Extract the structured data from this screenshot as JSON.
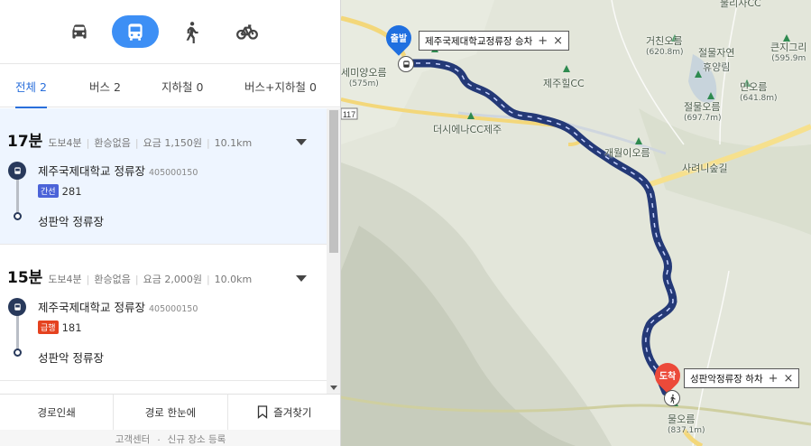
{
  "modes": [
    {
      "key": "car",
      "icon": "car-icon",
      "active": false
    },
    {
      "key": "transit",
      "icon": "bus-icon",
      "active": true
    },
    {
      "key": "walk",
      "icon": "walk-icon",
      "active": false
    },
    {
      "key": "bike",
      "icon": "bicycle-icon",
      "active": false
    }
  ],
  "tabs": [
    {
      "label": "전체 2",
      "active": true
    },
    {
      "label": "버스 2",
      "active": false
    },
    {
      "label": "지하철 0",
      "active": false
    },
    {
      "label": "버스+지하철 0",
      "active": false
    }
  ],
  "routes": [
    {
      "duration": "17분",
      "walk": "도보4분",
      "transfer": "환승없음",
      "fare": "요금 1,150원",
      "distance": "10.1km",
      "start_stop": "제주국제대학교 정류장",
      "stop_id": "405000150",
      "badge": "간선",
      "badge_color": "#4b63d8",
      "bus_no": "281",
      "end_stop": "성판악 정류장"
    },
    {
      "duration": "15분",
      "walk": "도보4분",
      "transfer": "환승없음",
      "fare": "요금 2,000원",
      "distance": "10.0km",
      "start_stop": "제주국제대학교 정류장",
      "stop_id": "405000150",
      "badge": "급행",
      "badge_color": "#e5421f",
      "bus_no": "181",
      "end_stop": "성판악 정류장"
    }
  ],
  "bottom": {
    "print": "경로인쇄",
    "overview": "경로 한눈에",
    "favorite": "즐겨찾기"
  },
  "footer": {
    "support": "고객센터",
    "new_place": "신규 장소 등록"
  },
  "map": {
    "start_pin": "출발",
    "end_pin": "도착",
    "start_callout": "제주국제대학교정류장 승차",
    "end_callout": "성판악정류장 하차",
    "road_no": "117",
    "labels": [
      {
        "name": "세미양오름",
        "sub": "(575m)"
      },
      {
        "name": "제주힐CC",
        "sub": ""
      },
      {
        "name": "더시에나CC제주",
        "sub": ""
      },
      {
        "name": "거친오름",
        "sub": "(620.8m)"
      },
      {
        "name": "절물자연",
        "sub": "휴양림"
      },
      {
        "name": "민오름",
        "sub": "(641.8m)"
      },
      {
        "name": "절물오름",
        "sub": "(697.7m)"
      },
      {
        "name": "큰지그리",
        "sub": "(595.9m"
      },
      {
        "name": "개월이오름",
        "sub": ""
      },
      {
        "name": "사려니숲길",
        "sub": ""
      },
      {
        "name": "물오름",
        "sub": "(837.1m)"
      },
      {
        "name": "물리사CC",
        "sub": ""
      }
    ]
  },
  "colors": {
    "accent": "#3d8ff5",
    "route_line": "#243977",
    "start_pin": "#1f6fe0",
    "end_pin": "#ec4a3a"
  }
}
